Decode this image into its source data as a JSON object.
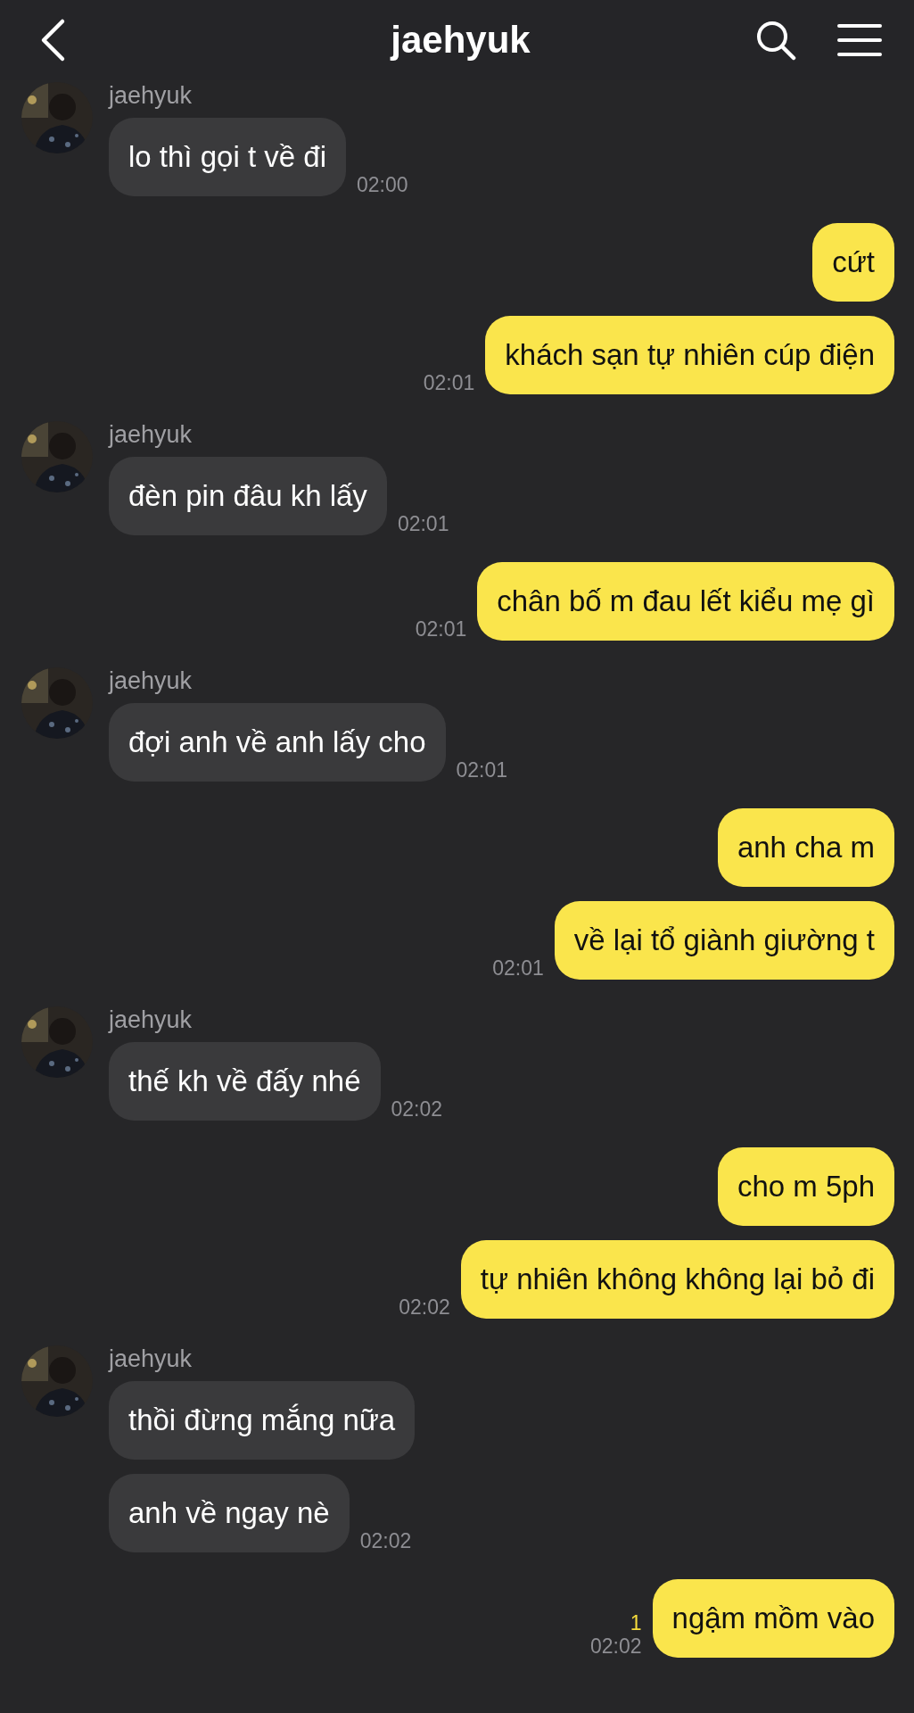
{
  "header": {
    "title": "jaehyuk"
  },
  "groups": [
    {
      "kind": "incoming",
      "name": "jaehyuk",
      "messages": [
        {
          "text": "lo thì gọi t về đi",
          "time": "02:00"
        }
      ]
    },
    {
      "kind": "outgoing",
      "messages": [
        {
          "text": "cứt"
        },
        {
          "text": "khách sạn tự nhiên cúp điện",
          "time": "02:01"
        }
      ]
    },
    {
      "kind": "incoming",
      "name": "jaehyuk",
      "messages": [
        {
          "text": "đèn pin đâu kh lấy",
          "time": "02:01"
        }
      ]
    },
    {
      "kind": "outgoing",
      "messages": [
        {
          "text": "chân bố m đau lết kiểu mẹ gì",
          "time": "02:01"
        }
      ]
    },
    {
      "kind": "incoming",
      "name": "jaehyuk",
      "messages": [
        {
          "text": "đợi anh về anh lấy cho",
          "time": "02:01"
        }
      ]
    },
    {
      "kind": "outgoing",
      "messages": [
        {
          "text": "anh cha m"
        },
        {
          "text": "về lại tổ giành giường t",
          "time": "02:01"
        }
      ]
    },
    {
      "kind": "incoming",
      "name": "jaehyuk",
      "messages": [
        {
          "text": "thế kh về đấy nhé",
          "time": "02:02"
        }
      ]
    },
    {
      "kind": "outgoing",
      "messages": [
        {
          "text": "cho m 5ph"
        },
        {
          "text": "tự nhiên không không lại bỏ đi",
          "time": "02:02"
        }
      ]
    },
    {
      "kind": "incoming",
      "name": "jaehyuk",
      "messages": [
        {
          "text": "thồi đừng mắng nữa"
        },
        {
          "text": "anh về ngay nè",
          "time": "02:02"
        }
      ]
    },
    {
      "kind": "outgoing",
      "messages": [
        {
          "text": "ngậm mồm vào",
          "time": "02:02",
          "unread": "1"
        }
      ]
    }
  ]
}
